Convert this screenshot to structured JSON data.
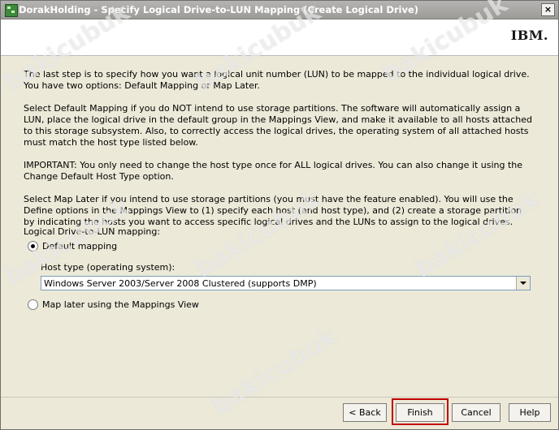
{
  "window": {
    "title": "DorakHolding - Specify Logical Drive-to-LUN Mapping (Create Logical Drive)",
    "close_symbol": "×"
  },
  "header": {
    "logo_text": "IBM."
  },
  "instructions": [
    "The last step is to specify how you want a logical unit number (LUN) to be mapped to the individual logical drive. You have two options: Default Mapping or Map Later.",
    "Select Default Mapping if you do NOT intend to use storage partitions. The software will automatically assign a LUN, place the logical drive in the default group in the Mappings View, and make it available to all hosts attached to this storage subsystem. Also, to correctly access the logical drives, the operating system of all attached hosts must match the host type listed below.",
    "IMPORTANT: You only need to change the host type once for ALL logical drives. You can also change it using the Change Default Host Type option.",
    "Select Map Later if you intend to use storage partitions (you must have the feature enabled). You will use the Define options in the Mappings View to (1) specify each host (and host type), and (2) create a storage partition by indicating the hosts you want to access specific logical drives and the LUNs to assign to the logical drives."
  ],
  "mapping": {
    "section_label": "Logical Drive-to-LUN mapping:",
    "default_option": "Default mapping",
    "default_selected": true,
    "host_type_label": "Host type (operating system):",
    "host_type_value": "Windows Server 2003/Server 2008 Clustered (supports DMP)",
    "later_option": "Map later using the Mappings View",
    "later_selected": false
  },
  "buttons": {
    "back": "< Back",
    "finish": "Finish",
    "cancel": "Cancel",
    "help": "Help"
  },
  "watermark_text": "bakicubuk",
  "colors": {
    "titlebar": "#a8a7a4",
    "dialog_bg": "#ece9d8",
    "highlight": "#c20000"
  }
}
